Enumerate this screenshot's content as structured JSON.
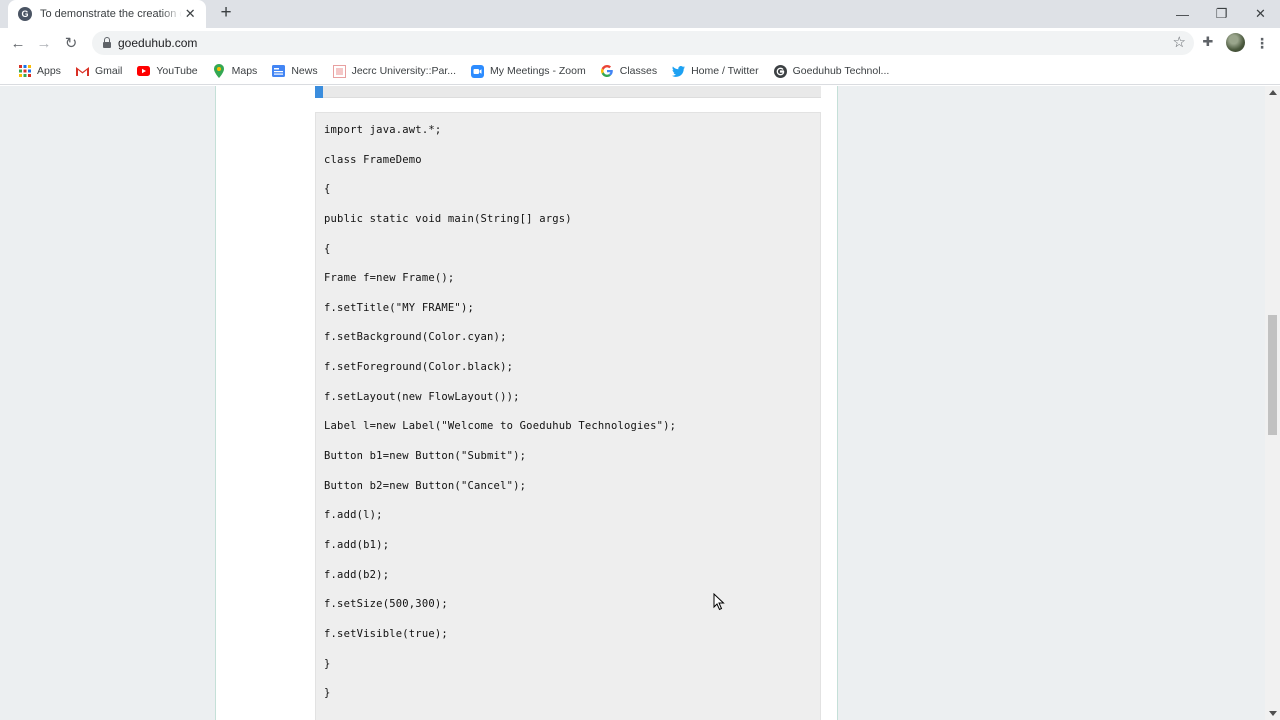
{
  "tab": {
    "favicon_letter": "G",
    "title": "To demonstrate the creation of a frame",
    "close_glyph": "✕",
    "new_tab_glyph": "+"
  },
  "window_controls": {
    "minimize": "—",
    "restore": "❐",
    "close": "✕"
  },
  "toolbar": {
    "back": "←",
    "forward": "→",
    "reload": "↻",
    "url": "goeduhub.com",
    "star": "☆",
    "extensions": "✚",
    "menu": "⋮"
  },
  "bookmarks": [
    {
      "label": "Apps",
      "icon": "apps-grid-icon"
    },
    {
      "label": "Gmail",
      "icon": "gmail-icon"
    },
    {
      "label": "YouTube",
      "icon": "youtube-icon"
    },
    {
      "label": "Maps",
      "icon": "maps-icon"
    },
    {
      "label": "News",
      "icon": "news-icon"
    },
    {
      "label": "Jecrc University::Par...",
      "icon": "jecrc-icon"
    },
    {
      "label": "My Meetings - Zoom",
      "icon": "zoom-icon"
    },
    {
      "label": "Classes",
      "icon": "google-icon"
    },
    {
      "label": "Home / Twitter",
      "icon": "twitter-icon"
    },
    {
      "label": "Goeduhub Technol...",
      "icon": "goeduhub-icon"
    }
  ],
  "code_lines": [
    "import java.awt.*;",
    "class FrameDemo",
    "{",
    "public static void main(String[] args)",
    "{",
    "Frame f=new Frame();",
    "f.setTitle(\"MY FRAME\");",
    "f.setBackground(Color.cyan);",
    "f.setForeground(Color.black);",
    "f.setLayout(new FlowLayout());",
    "Label l=new Label(\"Welcome to Goeduhub Technologies\");",
    "Button b1=new Button(\"Submit\");",
    "Button b2=new Button(\"Cancel\");",
    "f.add(l);",
    "f.add(b1);",
    "f.add(b2);",
    "f.setSize(500,300);",
    "f.setVisible(true);",
    "}",
    "}"
  ],
  "colors": {
    "accent": "#3b8ddd",
    "page_background": "#eceff1",
    "code_background": "#eeeeee"
  }
}
